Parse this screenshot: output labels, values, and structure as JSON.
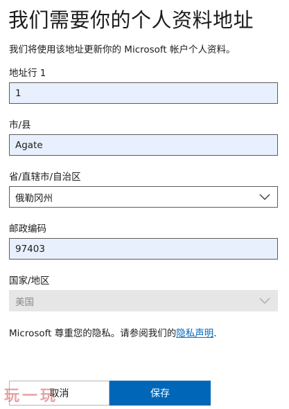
{
  "header": {
    "title": "我们需要你的个人资料地址",
    "description": "我们将使用该地址更新你的 Microsoft 帐户个人资料。"
  },
  "form": {
    "address_line1": {
      "label": "地址行 1",
      "value": "1"
    },
    "city": {
      "label": "市/县",
      "value": "Agate"
    },
    "state": {
      "label": "省/直辖市/自治区",
      "selected": "俄勒冈州",
      "icon": "chevron-down-icon"
    },
    "postal_code": {
      "label": "邮政编码",
      "value": "97403"
    },
    "country": {
      "label": "国家/地区",
      "selected": "美国",
      "disabled": true,
      "icon": "chevron-down-icon"
    }
  },
  "privacy": {
    "prefix": "Microsoft 尊重您的隐私。请参阅我们的",
    "link_text": "隐私声明",
    "suffix": "."
  },
  "buttons": {
    "cancel_label": "取消",
    "save_label": "保存"
  },
  "watermark": {
    "text": "玩一玩"
  },
  "colors": {
    "accent": "#0067b8",
    "autofill_background": "#e8f0fe",
    "disabled_background": "#e6e6e6"
  }
}
